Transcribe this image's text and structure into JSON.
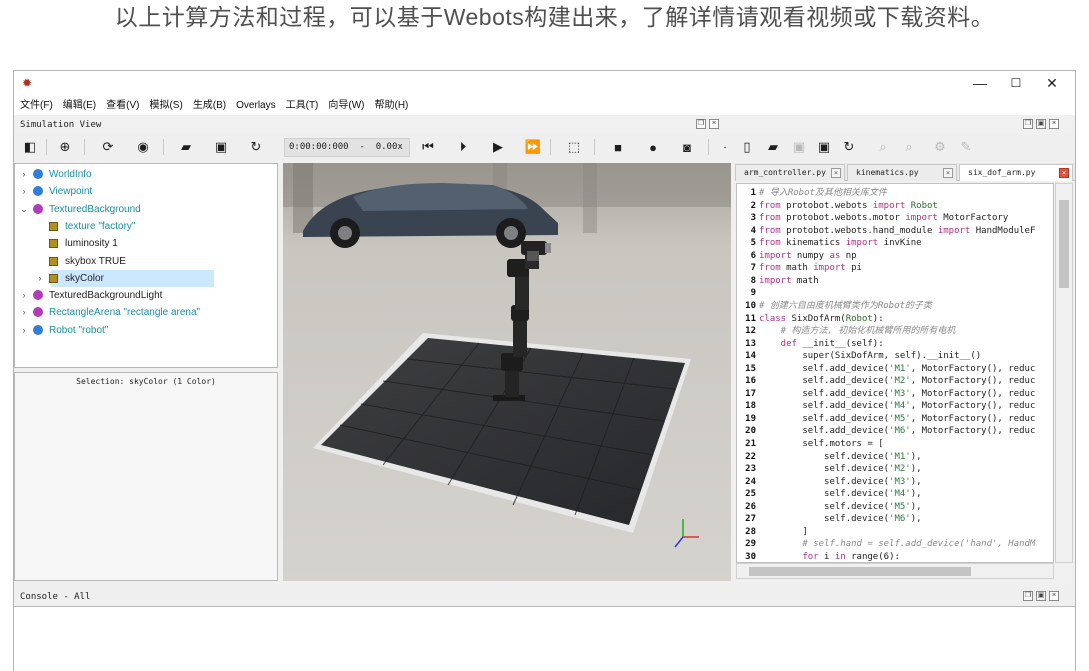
{
  "caption": "以上计算方法和过程，可以基于Webots构建出来，了解详情请观看视频或下载资料。",
  "window": {
    "minimize": "—",
    "maximize": "☐",
    "close": "✕"
  },
  "menu": [
    "文件(F)",
    "编辑(E)",
    "查看(V)",
    "模拟(S)",
    "生成(B)",
    "Overlays",
    "工具(T)",
    "向导(W)",
    "帮助(H)"
  ],
  "simulation_view": {
    "title": "Simulation View",
    "time": "0:00:00:000  -  0.00x"
  },
  "scene_tree": [
    {
      "arrow": "›",
      "type": "dot",
      "color": "#2f7fd8",
      "label": "WorldInfo",
      "indent": 0,
      "style": "teal"
    },
    {
      "arrow": "›",
      "type": "dot",
      "color": "#2f7fd8",
      "label": "Viewpoint",
      "indent": 0,
      "style": "teal"
    },
    {
      "arrow": "⌄",
      "type": "dot",
      "color": "#b33ab8",
      "label": "TexturedBackground",
      "indent": 0,
      "style": "teal"
    },
    {
      "arrow": "",
      "type": "sq",
      "color": "#b09020",
      "label": "texture \"factory\"",
      "indent": 1,
      "style": "teal"
    },
    {
      "arrow": "",
      "type": "sq",
      "color": "#b09020",
      "label": "luminosity 1",
      "indent": 1,
      "style": "dark"
    },
    {
      "arrow": "",
      "type": "sq",
      "color": "#b09020",
      "label": "skybox TRUE",
      "indent": 1,
      "style": "dark"
    },
    {
      "arrow": "›",
      "type": "sq",
      "color": "#b09020",
      "label": "skyColor",
      "indent": 1,
      "style": "dark",
      "selected": true
    },
    {
      "arrow": "›",
      "type": "dot",
      "color": "#b33ab8",
      "label": "TexturedBackgroundLight",
      "indent": 0,
      "style": "dark"
    },
    {
      "arrow": "›",
      "type": "dot",
      "color": "#b33ab8",
      "label": "RectangleArena \"rectangle arena\"",
      "indent": 0,
      "style": "teal"
    },
    {
      "arrow": "›",
      "type": "dot",
      "color": "#2f7fd8",
      "label": "Robot \"robot\"",
      "indent": 0,
      "style": "teal"
    }
  ],
  "selection": "Selection: skyColor (1 Color)",
  "editor": {
    "tabs": [
      {
        "label": "arm_controller.py",
        "active": false
      },
      {
        "label": "kinematics.py",
        "active": false
      },
      {
        "label": "six_dof_arm.py",
        "active": true
      }
    ],
    "lines": [
      {
        "n": "1",
        "parts": [
          [
            "cm",
            "# 导入Robot及其他相关库文件"
          ]
        ]
      },
      {
        "n": "2",
        "parts": [
          [
            "kw",
            "from"
          ],
          [
            "nm",
            " protobot.webots "
          ],
          [
            "kw",
            "import"
          ],
          [
            "cl",
            " Robot"
          ]
        ]
      },
      {
        "n": "3",
        "parts": [
          [
            "kw",
            "from"
          ],
          [
            "nm",
            " protobot.webots.motor "
          ],
          [
            "kw",
            "import"
          ],
          [
            "nm",
            " MotorFactory"
          ]
        ]
      },
      {
        "n": "4",
        "parts": [
          [
            "kw",
            "from"
          ],
          [
            "nm",
            " protobot.webots.hand_module "
          ],
          [
            "kw",
            "import"
          ],
          [
            "nm",
            " HandModuleF"
          ]
        ]
      },
      {
        "n": "5",
        "parts": [
          [
            "kw",
            "from"
          ],
          [
            "nm",
            " kinematics "
          ],
          [
            "kw",
            "import"
          ],
          [
            "nm",
            " invKine"
          ]
        ]
      },
      {
        "n": "6",
        "parts": [
          [
            "kw",
            "import"
          ],
          [
            "nm",
            " numpy "
          ],
          [
            "kw",
            "as"
          ],
          [
            "nm",
            " np"
          ]
        ]
      },
      {
        "n": "7",
        "parts": [
          [
            "kw",
            "from"
          ],
          [
            "nm",
            " math "
          ],
          [
            "kw",
            "import"
          ],
          [
            "nm",
            " pi"
          ]
        ]
      },
      {
        "n": "8",
        "parts": [
          [
            "kw",
            "import"
          ],
          [
            "nm",
            " math"
          ]
        ]
      },
      {
        "n": "9",
        "parts": [
          [
            "nm",
            ""
          ]
        ]
      },
      {
        "n": "10",
        "parts": [
          [
            "cm",
            "# 创建六自由度机械臂类作为Robot的子类"
          ]
        ]
      },
      {
        "n": "11",
        "parts": [
          [
            "kw",
            "class"
          ],
          [
            "nm",
            " SixDofArm("
          ],
          [
            "cl",
            "Robot"
          ],
          [
            "nm",
            "):"
          ]
        ]
      },
      {
        "n": "12",
        "parts": [
          [
            "cm",
            "    # 构造方法, 初始化机械臂所用的所有电机"
          ]
        ]
      },
      {
        "n": "13",
        "parts": [
          [
            "kw",
            "    def"
          ],
          [
            "nm",
            " __init__(self):"
          ]
        ]
      },
      {
        "n": "14",
        "parts": [
          [
            "nm",
            "        super(SixDofArm, self).__init__()"
          ]
        ]
      },
      {
        "n": "15",
        "parts": [
          [
            "nm",
            "        self.add_device("
          ],
          [
            "st",
            "'M1'"
          ],
          [
            "nm",
            ", MotorFactory(), reduc"
          ]
        ]
      },
      {
        "n": "16",
        "parts": [
          [
            "nm",
            "        self.add_device("
          ],
          [
            "st",
            "'M2'"
          ],
          [
            "nm",
            ", MotorFactory(), reduc"
          ]
        ]
      },
      {
        "n": "17",
        "parts": [
          [
            "nm",
            "        self.add_device("
          ],
          [
            "st",
            "'M3'"
          ],
          [
            "nm",
            ", MotorFactory(), reduc"
          ]
        ]
      },
      {
        "n": "18",
        "parts": [
          [
            "nm",
            "        self.add_device("
          ],
          [
            "st",
            "'M4'"
          ],
          [
            "nm",
            ", MotorFactory(), reduc"
          ]
        ]
      },
      {
        "n": "19",
        "parts": [
          [
            "nm",
            "        self.add_device("
          ],
          [
            "st",
            "'M5'"
          ],
          [
            "nm",
            ", MotorFactory(), reduc"
          ]
        ]
      },
      {
        "n": "20",
        "parts": [
          [
            "nm",
            "        self.add_device("
          ],
          [
            "st",
            "'M6'"
          ],
          [
            "nm",
            ", MotorFactory(), reduc"
          ]
        ]
      },
      {
        "n": "21",
        "parts": [
          [
            "nm",
            "        self.motors = ["
          ]
        ]
      },
      {
        "n": "22",
        "parts": [
          [
            "nm",
            "            self.device("
          ],
          [
            "st",
            "'M1'"
          ],
          [
            "nm",
            "),"
          ]
        ]
      },
      {
        "n": "23",
        "parts": [
          [
            "nm",
            "            self.device("
          ],
          [
            "st",
            "'M2'"
          ],
          [
            "nm",
            "),"
          ]
        ]
      },
      {
        "n": "24",
        "parts": [
          [
            "nm",
            "            self.device("
          ],
          [
            "st",
            "'M3'"
          ],
          [
            "nm",
            "),"
          ]
        ]
      },
      {
        "n": "25",
        "parts": [
          [
            "nm",
            "            self.device("
          ],
          [
            "st",
            "'M4'"
          ],
          [
            "nm",
            "),"
          ]
        ]
      },
      {
        "n": "26",
        "parts": [
          [
            "nm",
            "            self.device("
          ],
          [
            "st",
            "'M5'"
          ],
          [
            "nm",
            "),"
          ]
        ]
      },
      {
        "n": "27",
        "parts": [
          [
            "nm",
            "            self.device("
          ],
          [
            "st",
            "'M6'"
          ],
          [
            "nm",
            "),"
          ]
        ]
      },
      {
        "n": "28",
        "parts": [
          [
            "nm",
            "        ]"
          ]
        ]
      },
      {
        "n": "29",
        "parts": [
          [
            "cm",
            "        # self.hand = self.add_device('hand', HandM"
          ]
        ]
      },
      {
        "n": "30",
        "parts": [
          [
            "kw",
            "        for"
          ],
          [
            "nm",
            " i "
          ],
          [
            "kw",
            "in"
          ],
          [
            "nm",
            " range(6):"
          ]
        ]
      }
    ]
  },
  "console": {
    "title": "Console - All"
  },
  "colors": {
    "accent_selection": "#cce8ff",
    "tab_close_active": "#e0523a",
    "keyword": "#b0308a",
    "string": "#2e7a3e"
  }
}
